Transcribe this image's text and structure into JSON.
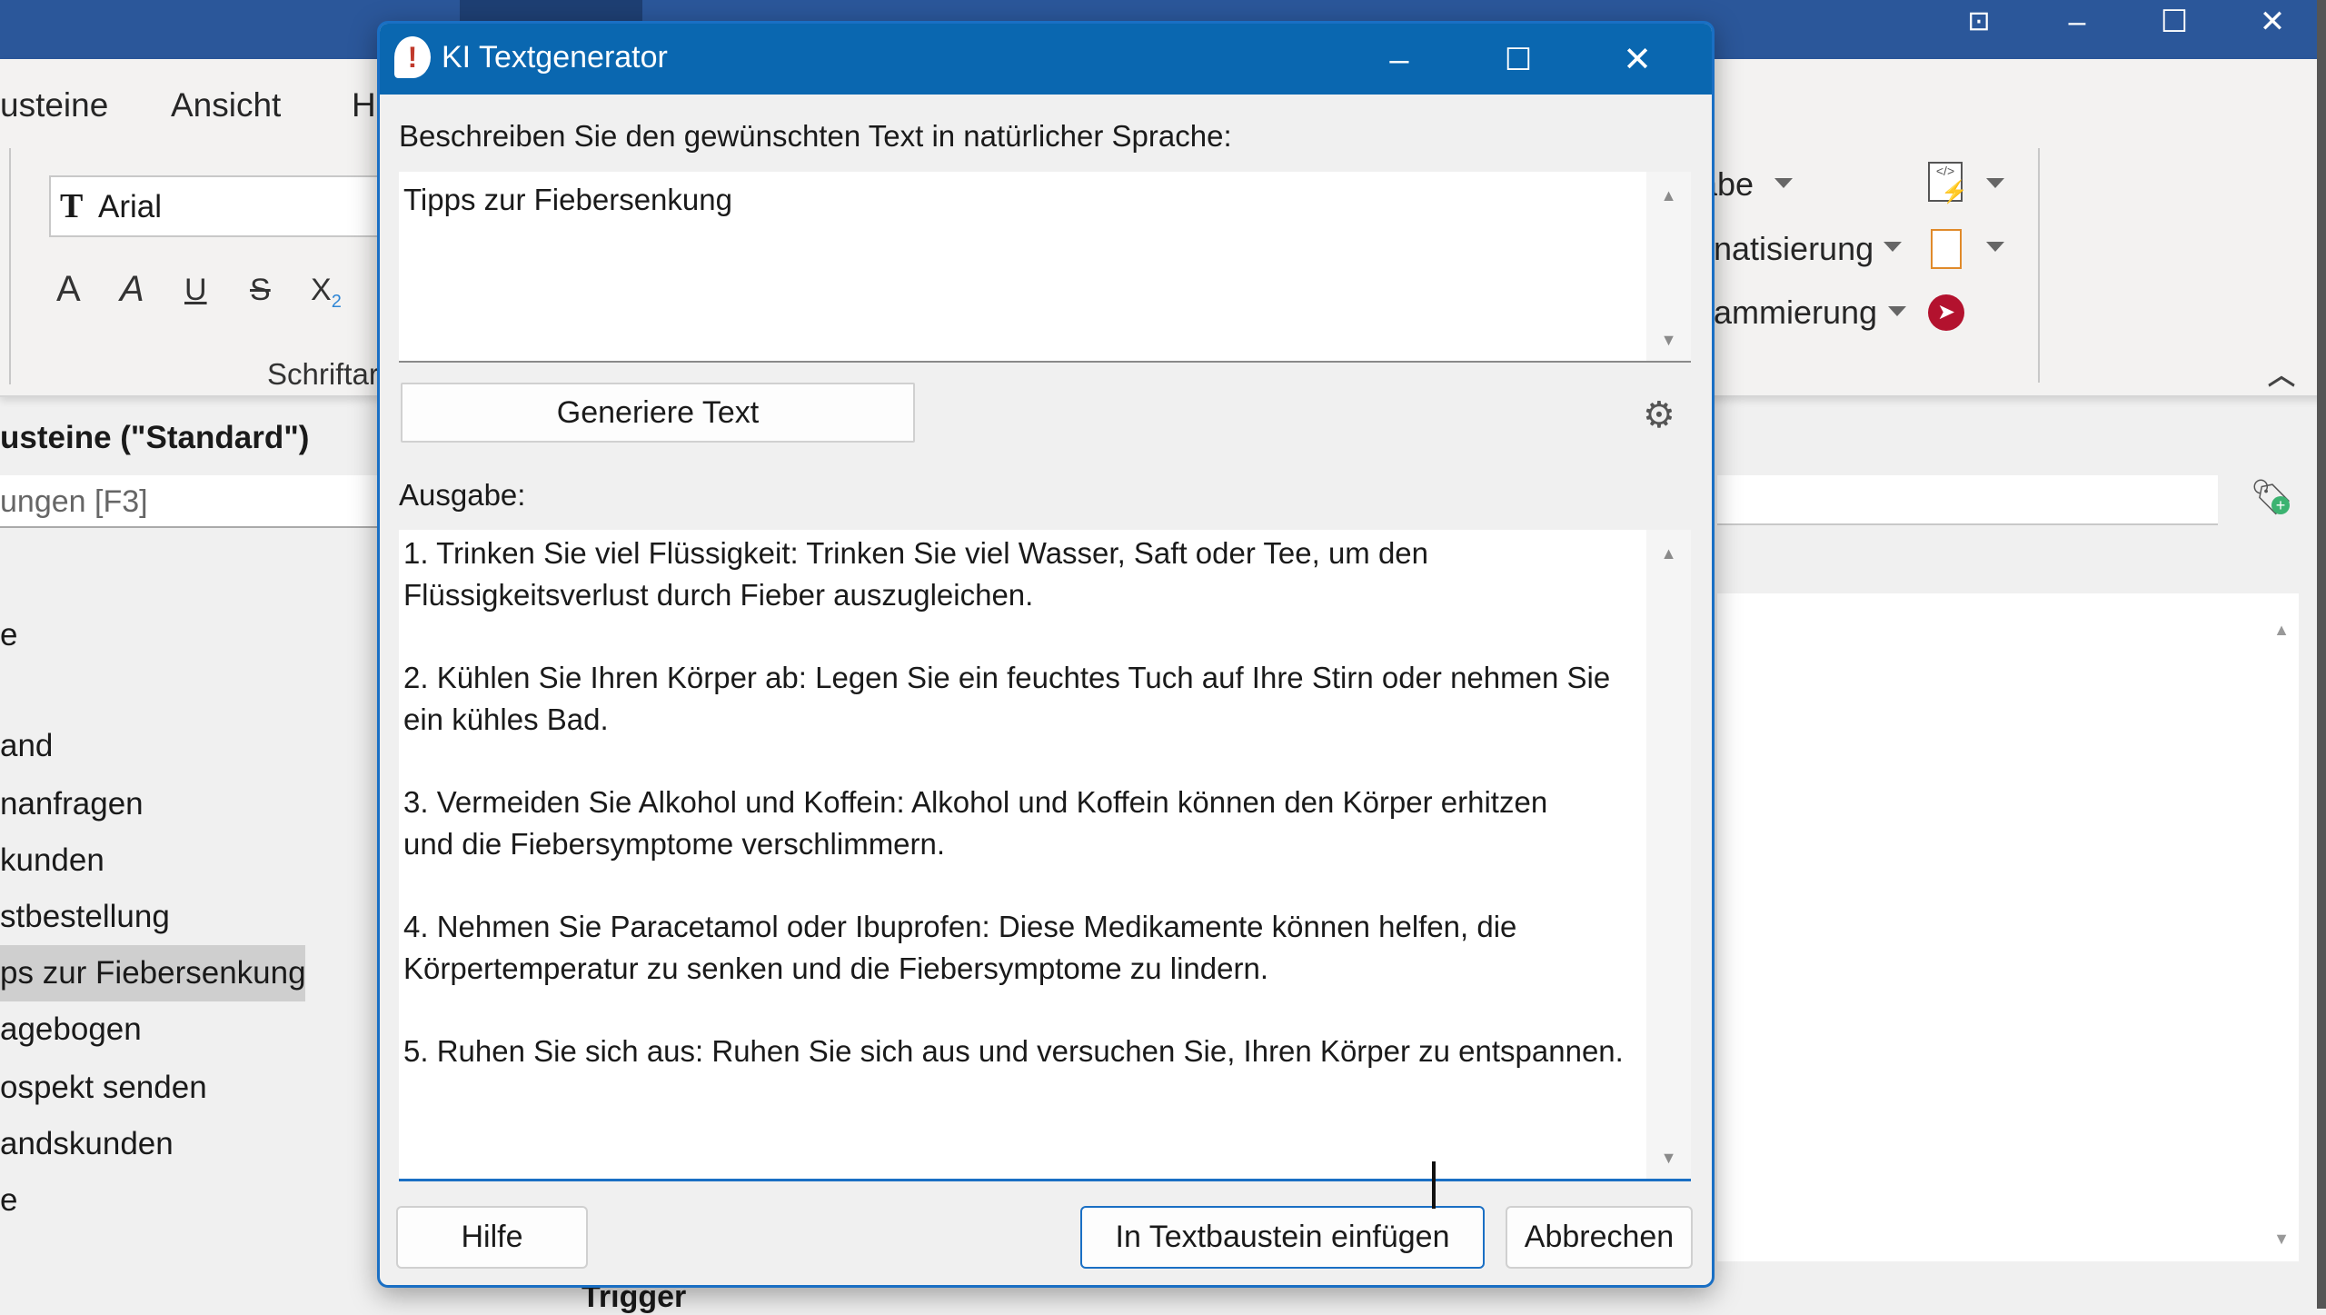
{
  "app": {
    "menu_tabs": [
      "usteine",
      "Ansicht",
      "H"
    ],
    "font": {
      "icon": "font-icon",
      "value": "Arial"
    },
    "format_buttons": [
      {
        "name": "bold",
        "glyph": "A"
      },
      {
        "name": "italic",
        "glyph": "A"
      },
      {
        "name": "underline",
        "glyph": "U"
      },
      {
        "name": "strikethrough",
        "glyph": "S"
      },
      {
        "name": "subscript",
        "glyph": "X",
        "sub": "2"
      }
    ],
    "font_group_label": "Schriftar",
    "right_ribbon": [
      "abe",
      "natisierung",
      "ammierung"
    ],
    "pane_title": "usteine (\"Standard\")",
    "search_placeholder": "ungen [F3]",
    "list": [
      "e",
      "and",
      "nanfragen",
      "kunden",
      "stbestellung",
      "ps zur Fiebersenkung",
      "agebogen",
      "ospekt senden",
      "andskunden",
      "e"
    ],
    "selected_index": 5,
    "trigger_label": "Trigger",
    "colors": {
      "titlebar": "#2b579a",
      "dialog_title": "#0a67b0",
      "accent": "#1a6fc4"
    }
  },
  "dialog": {
    "title": "KI Textgenerator",
    "prompt_label": "Beschreiben Sie den gewünschten Text in natürlicher Sprache:",
    "prompt_value": "Tipps zur Fiebersenkung",
    "generate_label": "Generiere Text",
    "output_label": "Ausgabe:",
    "output_lines": [
      "1. Trinken Sie viel Flüssigkeit: Trinken Sie viel Wasser, Saft oder Tee, um den",
      "Flüssigkeitsverlust durch Fieber auszugleichen.",
      "",
      "2. Kühlen Sie Ihren Körper ab: Legen Sie ein feuchtes Tuch auf Ihre Stirn oder nehmen Sie",
      "ein kühles Bad.",
      "",
      "3. Vermeiden Sie Alkohol und Koffein: Alkohol und Koffein können den Körper erhitzen",
      "und die Fiebersymptome verschlimmern.",
      "",
      "4. Nehmen Sie Paracetamol oder Ibuprofen: Diese Medikamente können helfen, die",
      "Körpertemperatur zu senken und die Fiebersymptome zu lindern.",
      "",
      "5. Ruhen Sie sich aus: Ruhen Sie sich aus und versuchen Sie, Ihren Körper zu entspannen."
    ],
    "help_label": "Hilfe",
    "insert_label": "In Textbaustein einfügen",
    "cancel_label": "Abbrechen"
  }
}
